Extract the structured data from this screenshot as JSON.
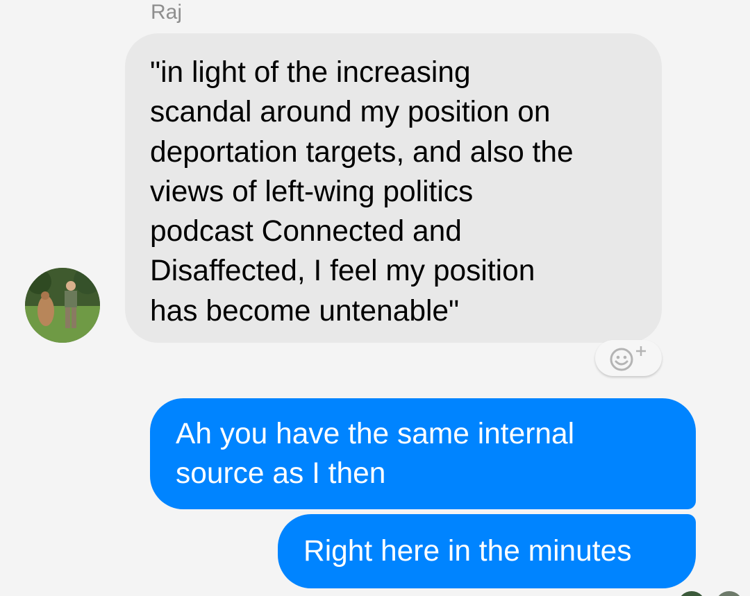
{
  "thread": {
    "sender_name": "Raj",
    "incoming_message": "\"in light of the increasing\nscandal around my position on\ndeportation targets, and also the\nviews of left-wing politics\npodcast Connected and\nDisaffected, I feel my position\nhas become untenable\"",
    "react_icon": "add-reaction-icon",
    "outgoing_messages": [
      "Ah you have the same internal\nsource as I then",
      "Right here in the minutes"
    ]
  },
  "colors": {
    "background": "#f4f4f4",
    "incoming_bubble": "#e8e8e8",
    "outgoing_bubble": "#0084ff",
    "sender_name": "#8e8e8e"
  }
}
